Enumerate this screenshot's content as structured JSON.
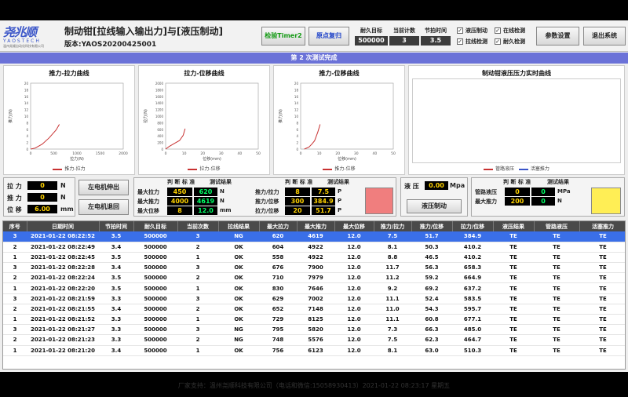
{
  "app": {
    "title": "制动钳[拉线输入输出力]与[液压制动]",
    "version": "版本:YAOS20200425001",
    "logo": {
      "mark": "尧兆顺",
      "en": "YAOSTECH",
      "cn": "温州尧顺自动化科技有限公司"
    }
  },
  "toolbar": {
    "timer_label": "检验Timer2",
    "reset_label": "原点复归",
    "settings_label": "参数设置",
    "exit_label": "退出系统"
  },
  "counters": {
    "target_label": "耐久目标",
    "target_value": "500000",
    "count_label": "当前计数",
    "count_value": "3",
    "cycle_label": "节拍时间",
    "cycle_value": "3.5"
  },
  "checks": [
    {
      "label": "液压制动",
      "checked": true
    },
    {
      "label": "在线检测",
      "checked": true
    },
    {
      "label": "拉线检测",
      "checked": true
    },
    {
      "label": "耐久检测",
      "checked": true
    }
  ],
  "banner": "第 2 次测试完成",
  "charts": [
    {
      "title": "推力-拉力曲线",
      "xlabel": "拉力(N)",
      "ylabel": "推力(N)",
      "legend": "推力-拉力",
      "xticks": [
        "0",
        "500",
        "1000",
        "1500",
        "2000"
      ],
      "yticks": [
        "20",
        "18",
        "16",
        "14",
        "12",
        "10",
        "8",
        "6",
        "4",
        "2",
        "0"
      ]
    },
    {
      "title": "拉力-位移曲线",
      "xlabel": "位移(mm)",
      "ylabel": "拉力(N)",
      "legend": "拉力-位移",
      "xticks": [
        "0",
        "10",
        "20",
        "30",
        "40",
        "50"
      ],
      "yticks": [
        "2000",
        "1800",
        "1600",
        "1400",
        "1200",
        "1000",
        "800",
        "600",
        "400",
        "200",
        "0"
      ]
    },
    {
      "title": "推力-位移曲线",
      "xlabel": "位移(mm)",
      "ylabel": "推力(N)",
      "legend": "推力-位移",
      "xticks": [
        "0",
        "10",
        "20",
        "30",
        "40",
        "50"
      ],
      "yticks": [
        "20",
        "18",
        "16",
        "14",
        "12",
        "10",
        "8",
        "6",
        "4",
        "2",
        "0"
      ]
    },
    {
      "title": "制动钳液压压力实时曲线",
      "legend_a": "管路液压",
      "legend_b": "活塞推力"
    }
  ],
  "chart_data": [
    {
      "type": "line",
      "title": "推力-拉力曲线",
      "xlabel": "拉力(N)",
      "ylabel": "推力(N)",
      "xlim": [
        0,
        2000
      ],
      "ylim": [
        0,
        20
      ],
      "series": [
        {
          "name": "推力-拉力",
          "x": [
            0,
            100,
            250,
            400,
            550,
            620
          ],
          "y": [
            0,
            0.3,
            1.5,
            3.4,
            5.8,
            7.5
          ]
        }
      ]
    },
    {
      "type": "line",
      "title": "拉力-位移曲线",
      "xlabel": "位移(mm)",
      "ylabel": "拉力(N)",
      "xlim": [
        0,
        50
      ],
      "ylim": [
        0,
        2000
      ],
      "series": [
        {
          "name": "拉力-位移",
          "x": [
            0,
            2,
            5,
            7.5,
            9.5,
            10.5
          ],
          "y": [
            0,
            80,
            180,
            260,
            420,
            620
          ]
        }
      ]
    },
    {
      "type": "line",
      "title": "推力-位移曲线",
      "xlabel": "位移(mm)",
      "ylabel": "推力(N)",
      "xlim": [
        0,
        50
      ],
      "ylim": [
        0,
        20
      ],
      "series": [
        {
          "name": "推力-位移",
          "x": [
            2,
            4.5,
            6,
            7.5,
            9.3,
            10.5
          ],
          "y": [
            0,
            0.6,
            1.5,
            2.5,
            5.2,
            7.5
          ]
        }
      ]
    }
  ],
  "manual": {
    "pull_label": "拉 力",
    "pull_value": "0",
    "pull_unit": "N",
    "push_label": "推 力",
    "push_value": "0",
    "push_unit": "N",
    "disp_label": "位 移",
    "disp_value": "6.00",
    "disp_unit": "mm",
    "extend_label": "左电机伸出",
    "retract_label": "左电机退回"
  },
  "judge1": {
    "head": "判 断 标 准",
    "result_head": "测试结果",
    "rows": [
      {
        "label": "最大拉力",
        "min": "450",
        "max": "620",
        "unit": "N"
      },
      {
        "label": "最大推力",
        "min": "4000",
        "max": "4619",
        "unit": "N"
      },
      {
        "label": "最大位移",
        "min": "8",
        "max": "12.0",
        "unit": "mm"
      }
    ],
    "result_color": "#f07e7e"
  },
  "judge2": {
    "head": "判 断 标 准",
    "result_head": "测试结果",
    "rows": [
      {
        "label": "推力/拉力",
        "min": "8",
        "max": "7.5",
        "unit": "P"
      },
      {
        "label": "推力/位移",
        "min": "300",
        "max": "384.9",
        "unit": "P"
      },
      {
        "label": "拉力/位移",
        "min": "20",
        "max": "51.7",
        "unit": "P"
      }
    ]
  },
  "hydraulic": {
    "label": "液 压",
    "value": "0.00",
    "unit": "Mpa",
    "button": "液压制动"
  },
  "judge3": {
    "head": "判 断 标 准",
    "result_head": "测试结果",
    "rows": [
      {
        "label": "管路液压",
        "min": "0",
        "max": "0",
        "unit": "MPa"
      },
      {
        "label": "最大推力",
        "min": "200",
        "max": "0",
        "unit": "N"
      }
    ],
    "result_color": "#ffee55"
  },
  "table": {
    "columns": [
      "序号",
      "日期时间",
      "节拍时间",
      "耐久目标",
      "当前次数",
      "拉线结果",
      "最大拉力",
      "最大推力",
      "最大位移",
      "推力/拉力",
      "推力/位移",
      "拉力/位移",
      "液压结果",
      "管路液压",
      "活塞推力"
    ],
    "rows": [
      [
        "3",
        "2021-01-22 08:22:52",
        "3.5",
        "500000",
        "3",
        "NG",
        "620",
        "4619",
        "12.0",
        "7.5",
        "51.7",
        "384.9",
        "TE",
        "TE",
        "TE"
      ],
      [
        "2",
        "2021-01-22 08:22:49",
        "3.4",
        "500000",
        "2",
        "OK",
        "604",
        "4922",
        "12.0",
        "8.1",
        "50.3",
        "410.2",
        "TE",
        "TE",
        "TE"
      ],
      [
        "1",
        "2021-01-22 08:22:45",
        "3.5",
        "500000",
        "1",
        "OK",
        "558",
        "4922",
        "12.0",
        "8.8",
        "46.5",
        "410.2",
        "TE",
        "TE",
        "TE"
      ],
      [
        "3",
        "2021-01-22 08:22:28",
        "3.4",
        "500000",
        "3",
        "OK",
        "676",
        "7900",
        "12.0",
        "11.7",
        "56.3",
        "658.3",
        "TE",
        "TE",
        "TE"
      ],
      [
        "2",
        "2021-01-22 08:22:24",
        "3.5",
        "500000",
        "2",
        "OK",
        "710",
        "7979",
        "12.0",
        "11.2",
        "59.2",
        "664.9",
        "TE",
        "TE",
        "TE"
      ],
      [
        "1",
        "2021-01-22 08:22:20",
        "3.5",
        "500000",
        "1",
        "OK",
        "830",
        "7646",
        "12.0",
        "9.2",
        "69.2",
        "637.2",
        "TE",
        "TE",
        "TE"
      ],
      [
        "3",
        "2021-01-22 08:21:59",
        "3.3",
        "500000",
        "3",
        "OK",
        "629",
        "7002",
        "12.0",
        "11.1",
        "52.4",
        "583.5",
        "TE",
        "TE",
        "TE"
      ],
      [
        "2",
        "2021-01-22 08:21:55",
        "3.4",
        "500000",
        "2",
        "OK",
        "652",
        "7148",
        "12.0",
        "11.0",
        "54.3",
        "595.7",
        "TE",
        "TE",
        "TE"
      ],
      [
        "1",
        "2021-01-22 08:21:52",
        "3.3",
        "500000",
        "1",
        "OK",
        "729",
        "8125",
        "12.0",
        "11.1",
        "60.8",
        "677.1",
        "TE",
        "TE",
        "TE"
      ],
      [
        "3",
        "2021-01-22 08:21:27",
        "3.3",
        "500000",
        "3",
        "NG",
        "795",
        "5820",
        "12.0",
        "7.3",
        "66.3",
        "485.0",
        "TE",
        "TE",
        "TE"
      ],
      [
        "2",
        "2021-01-22 08:21:23",
        "3.3",
        "500000",
        "2",
        "NG",
        "748",
        "5576",
        "12.0",
        "7.5",
        "62.3",
        "464.7",
        "TE",
        "TE",
        "TE"
      ],
      [
        "1",
        "2021-01-22 08:21:20",
        "3.4",
        "500000",
        "1",
        "OK",
        "756",
        "6123",
        "12.0",
        "8.1",
        "63.0",
        "510.3",
        "TE",
        "TE",
        "TE"
      ]
    ]
  },
  "footer": "厂家支持：温州尧顺科技有限公司（电话和微信:15058930413）2021-01-22 08:23:17 星期五"
}
